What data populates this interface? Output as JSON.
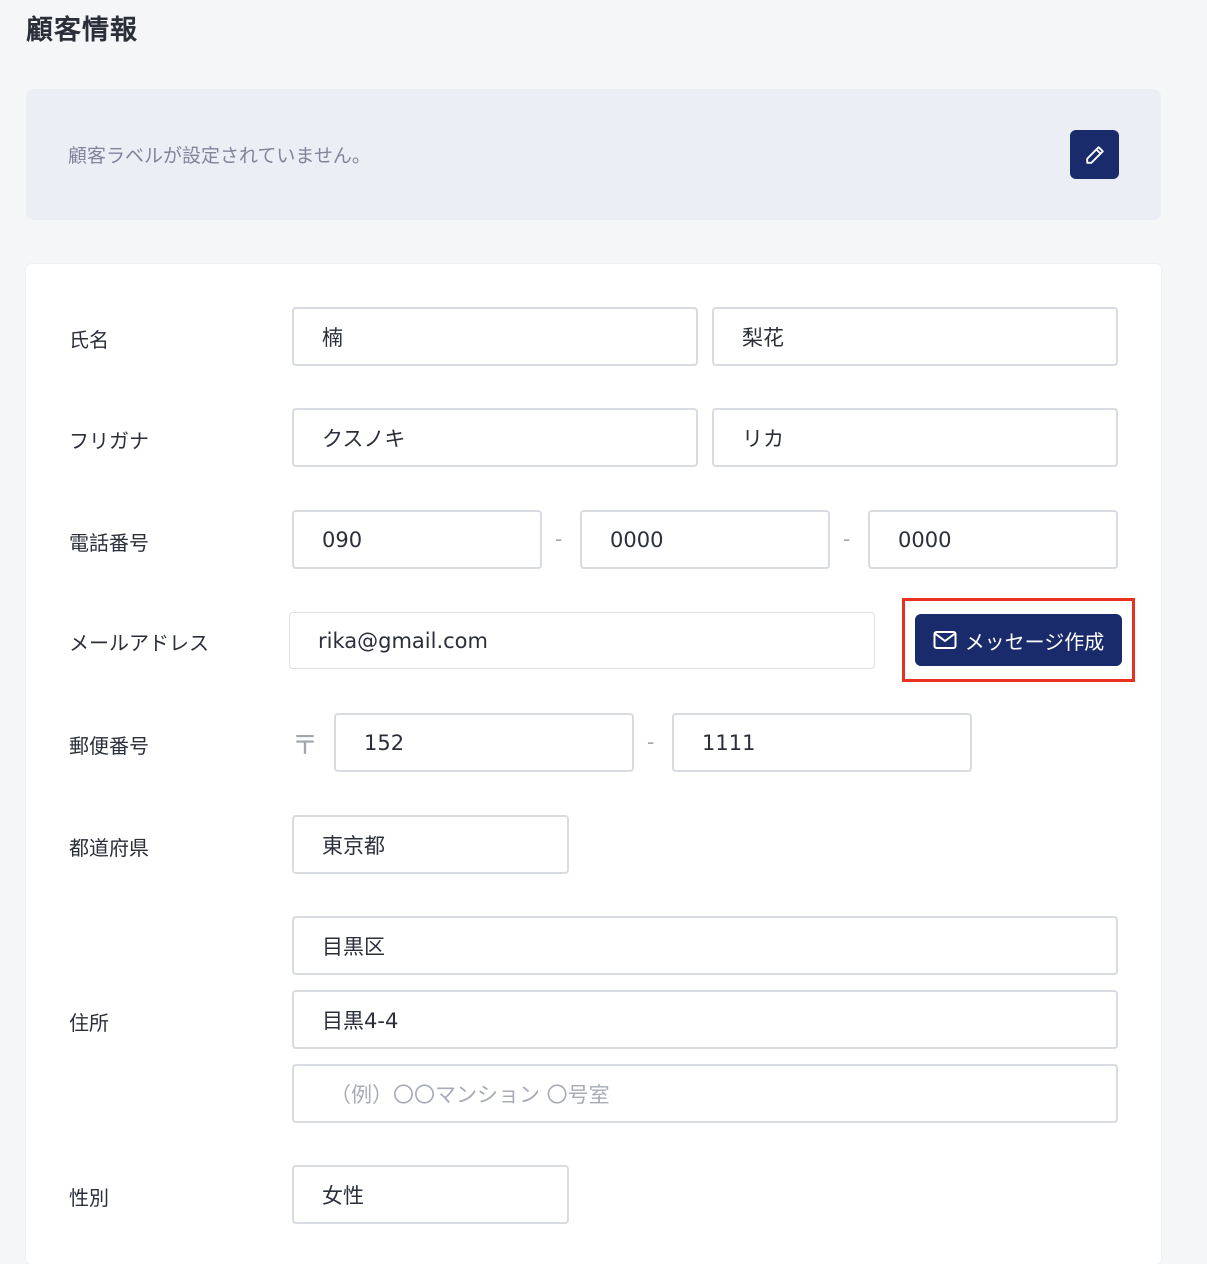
{
  "page_title": "顧客情報",
  "label_panel": {
    "empty_text": "顧客ラベルが設定されていません。",
    "edit_icon": "pencil-icon"
  },
  "form": {
    "name": {
      "label": "氏名",
      "last": "楠",
      "first": "梨花"
    },
    "kana": {
      "label": "フリガナ",
      "last": "クスノキ",
      "first": "リカ"
    },
    "phone": {
      "label": "電話番号",
      "part1": "090",
      "part2": "0000",
      "part3": "0000",
      "separator": "-"
    },
    "email": {
      "label": "メールアドレス",
      "value": "rika@gmail.com",
      "message_button": "メッセージ作成",
      "message_icon": "envelope-icon"
    },
    "postal": {
      "label": "郵便番号",
      "mark": "〒",
      "part1": "152",
      "part2": "1111",
      "separator": "-"
    },
    "prefecture": {
      "label": "都道府県",
      "value": "東京都"
    },
    "address": {
      "label": "住所",
      "city": "目黒区",
      "street": "目黒4-4",
      "building_placeholder": "（例）〇〇マンション 〇号室"
    },
    "gender": {
      "label": "性別",
      "value": "女性"
    }
  },
  "colors": {
    "primary": "#1a2b6b",
    "highlight": "#e8321f"
  }
}
